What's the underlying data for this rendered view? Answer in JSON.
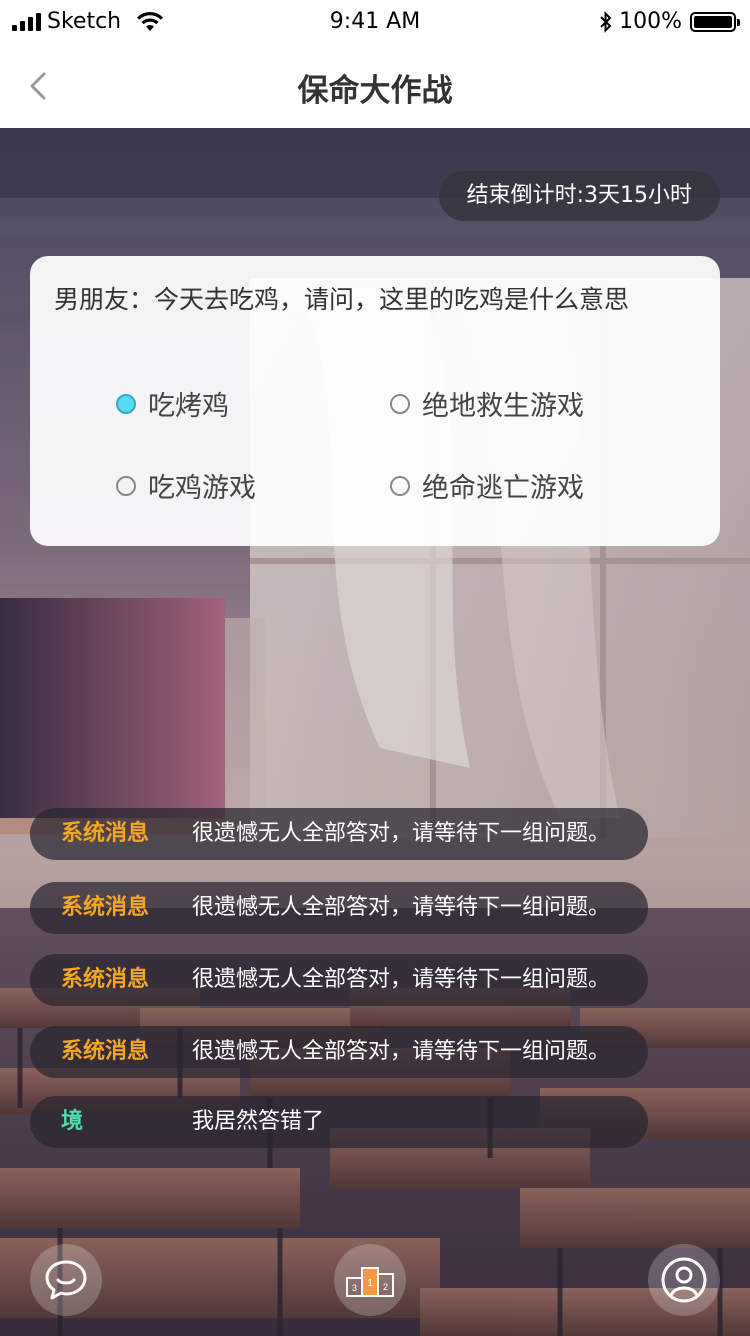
{
  "status_bar": {
    "carrier": "Sketch",
    "time": "9:41 AM",
    "battery": "100%"
  },
  "nav": {
    "title": "保命大作战",
    "back_icon": "chevron-left-icon"
  },
  "countdown": {
    "text": "结束倒计时:3天15小时"
  },
  "question": {
    "text": "男朋友：今天去吃鸡，请问，这里的吃鸡是什么意思",
    "options": [
      {
        "label": "吃烤鸡",
        "selected": true
      },
      {
        "label": "绝地救生游戏",
        "selected": false
      },
      {
        "label": "吃鸡游戏",
        "selected": false
      },
      {
        "label": "绝命逃亡游戏",
        "selected": false
      }
    ]
  },
  "messages": [
    {
      "sender": "系统消息",
      "text": "很遗憾无人全部答对，请等待下一组问题。",
      "sender_color": "#f5a623"
    },
    {
      "sender": "系统消息",
      "text": "很遗憾无人全部答对，请等待下一组问题。",
      "sender_color": "#f5a623"
    },
    {
      "sender": "系统消息",
      "text": "很遗憾无人全部答对，请等待下一组问题。",
      "sender_color": "#f5a623"
    },
    {
      "sender": "系统消息",
      "text": "很遗憾无人全部答对，请等待下一组问题。",
      "sender_color": "#f5a623"
    },
    {
      "sender": "境",
      "text": "我居然答错了",
      "sender_color": "#4ddcaa"
    }
  ],
  "bottom_bar": {
    "chat_icon": "chat-bubble-icon",
    "rank_icon": "podium-icon",
    "profile_icon": "user-profile-icon",
    "podium_labels": [
      "3",
      "1",
      "2"
    ]
  },
  "colors": {
    "accent_selected": "#5ad9f2",
    "system_sender": "#f5a623",
    "user_sender": "#4ddcaa"
  }
}
